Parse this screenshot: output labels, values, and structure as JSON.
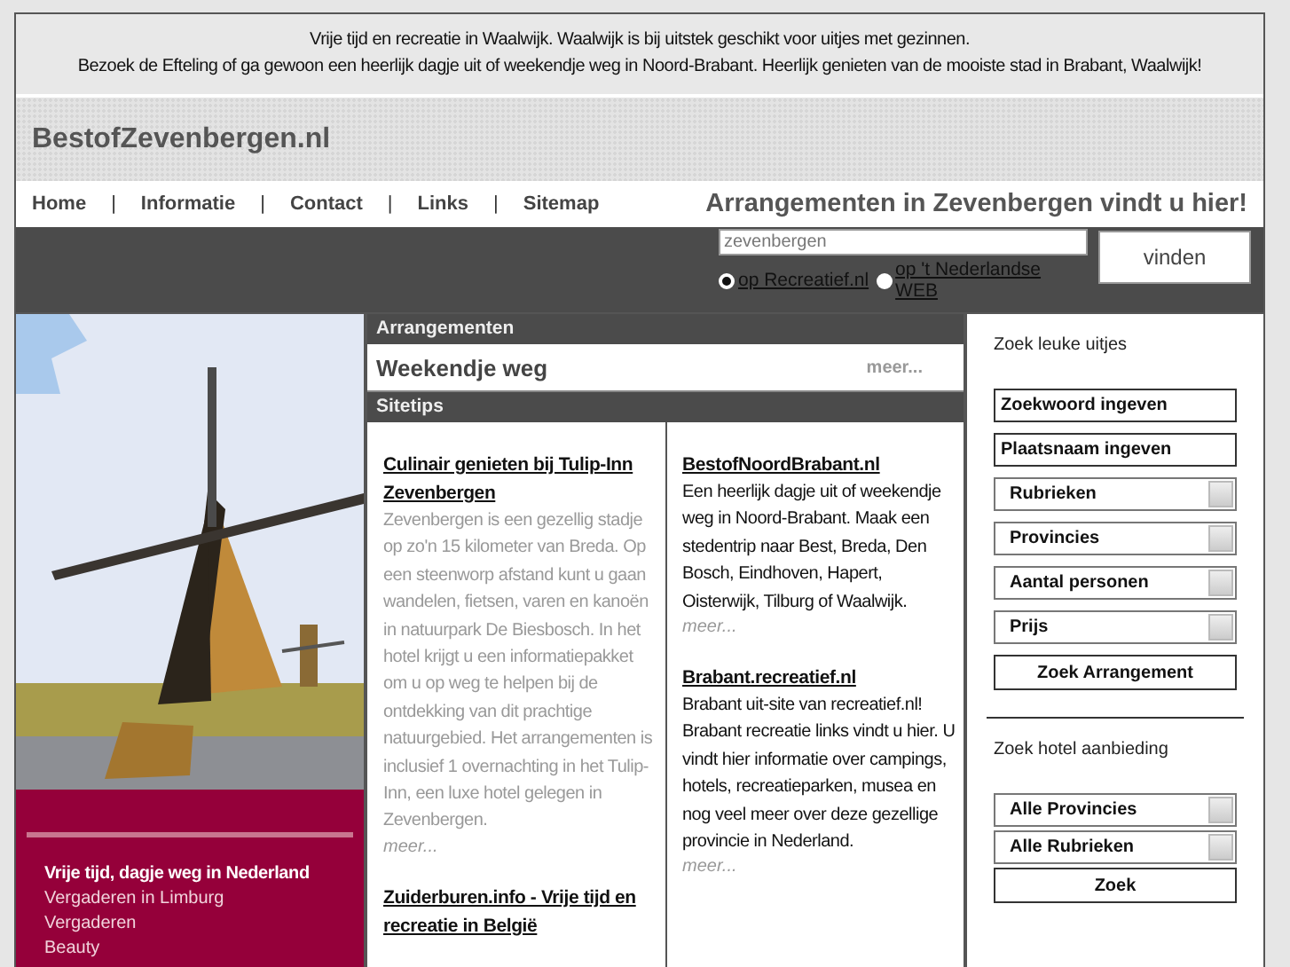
{
  "intro": [
    "Vrije tijd en recreatie in Waalwijk. Waalwijk is bij uitstek geschikt voor uitjes met gezinnen.",
    "Bezoek de Efteling of ga gewoon een heerlijk dagje uit of weekendje weg in Noord-Brabant. Heerlijk genieten van de mooiste stad in Brabant, Waalwijk!"
  ],
  "site_title": "BestofZevenbergen.nl",
  "nav": {
    "items": [
      "Home",
      "Informatie",
      "Contact",
      "Links",
      "Sitemap"
    ],
    "separator": "|",
    "tagline": "Arrangementen in Zevenbergen vindt u hier!"
  },
  "search": {
    "value": "zevenbergen",
    "button": "vinden",
    "options": [
      {
        "label": "op Recreatief.nl",
        "selected": true
      },
      {
        "label": "op 't Nederlandse WEB",
        "selected": false
      }
    ]
  },
  "left_menu": [
    {
      "label": "Vrije tijd, dagje weg in Nederland",
      "kind": "heading"
    },
    {
      "label": "Vergaderen in Limburg",
      "kind": "link"
    },
    {
      "label": "Vergaderen",
      "kind": "link"
    },
    {
      "label": "Beauty",
      "kind": "link"
    }
  ],
  "arrangementen": {
    "header": "Arrangementen",
    "title": "Weekendje weg",
    "more": "meer..."
  },
  "sitetips": {
    "header": "Sitetips",
    "columns": [
      [
        {
          "title": "Culinair genieten bij Tulip-Inn Zevenbergen",
          "text": "Zevenbergen is een gezellig stadje op zo'n 15 kilometer van Breda. Op een steenworp afstand kunt u gaan wandelen, fietsen, varen en kanoën in natuurpark De Biesbosch. In het hotel krijgt u een informatiepakket om u op weg te helpen bij de ontdekking van dit prachtige natuurgebied. Het arrangementen is inclusief 1 overnachting in het Tulip-Inn, een luxe hotel gelegen in Zevenbergen.",
          "more": "meer...",
          "muted": true
        },
        {
          "title": "Zuiderburen.info - Vrije tijd en recreatie in België"
        }
      ],
      [
        {
          "title": "BestofNoordBrabant.nl",
          "text": "Een heerlijk dagje uit of weekendje weg in Noord-Brabant. Maak een stedentrip naar Best, Breda, Den Bosch, Eindhoven, Hapert, Oisterwijk, Tilburg of Waalwijk.",
          "more": "meer...",
          "muted": false
        },
        {
          "title": "Brabant.recreatief.nl",
          "text": "Brabant uit-site van recreatief.nl! Brabant recreatie links vindt u hier. U vindt hier informatie over campings, hotels, recreatieparken, musea en nog veel meer over deze gezellige provincie in Nederland.",
          "more": "meer...",
          "muted": false
        }
      ]
    ]
  },
  "uitjes": {
    "title": "Zoek leuke uitjes",
    "controls": [
      {
        "kind": "input",
        "label": "Zoekwoord ingeven"
      },
      {
        "kind": "input",
        "label": "Plaatsnaam ingeven"
      },
      {
        "kind": "select",
        "label": "Rubrieken"
      },
      {
        "kind": "select",
        "label": "Provincies"
      },
      {
        "kind": "select",
        "label": "Aantal personen"
      },
      {
        "kind": "select",
        "label": "Prijs"
      },
      {
        "kind": "button",
        "label": "Zoek Arrangement"
      }
    ]
  },
  "hotel": {
    "title": "Zoek hotel aanbieding",
    "controls": [
      {
        "kind": "select",
        "label": "Alle Provincies"
      },
      {
        "kind": "select",
        "label": "Alle Rubrieken"
      },
      {
        "kind": "button",
        "label": "Zoek"
      }
    ]
  }
}
